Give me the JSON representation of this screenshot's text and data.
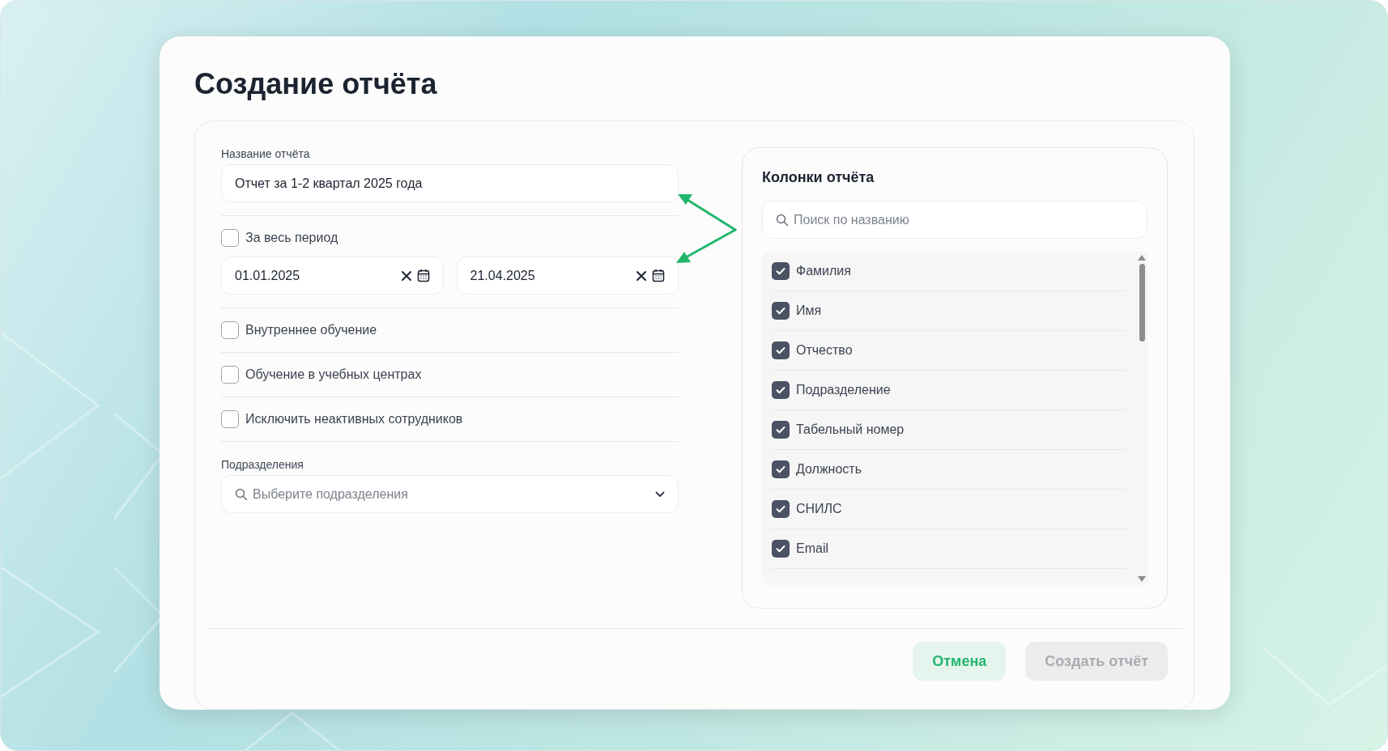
{
  "dialog": {
    "title": "Создание отчёта"
  },
  "report_name": {
    "label": "Название отчёта",
    "value": "Отчет за 1-2 квартал 2025 года"
  },
  "all_period": {
    "label": "За весь период",
    "checked": false
  },
  "date_from": {
    "value": "01.01.2025"
  },
  "date_to": {
    "value": "21.04.2025"
  },
  "filters": [
    {
      "label": "Внутреннее обучение",
      "checked": false
    },
    {
      "label": "Обучение в учебных центрах",
      "checked": false
    },
    {
      "label": "Исключить неактивных сотрудников",
      "checked": false
    }
  ],
  "departments": {
    "label": "Подразделения",
    "placeholder": "Выберите подразделения"
  },
  "columns_panel": {
    "title": "Колонки отчёта",
    "search": {
      "placeholder": "Поиск по названию"
    },
    "items": [
      {
        "label": "Фамилия",
        "checked": true
      },
      {
        "label": "Имя",
        "checked": true
      },
      {
        "label": "Отчество",
        "checked": true
      },
      {
        "label": "Подразделение",
        "checked": true
      },
      {
        "label": "Табельный номер",
        "checked": true
      },
      {
        "label": "Должность",
        "checked": true
      },
      {
        "label": "СНИЛС",
        "checked": true
      },
      {
        "label": "Email",
        "checked": true
      }
    ]
  },
  "buttons": [
    {
      "label": "Отмена",
      "kind": "secondary",
      "disabled": false
    },
    {
      "label": "Создать отчёт",
      "kind": "primary",
      "disabled": true
    }
  ]
}
